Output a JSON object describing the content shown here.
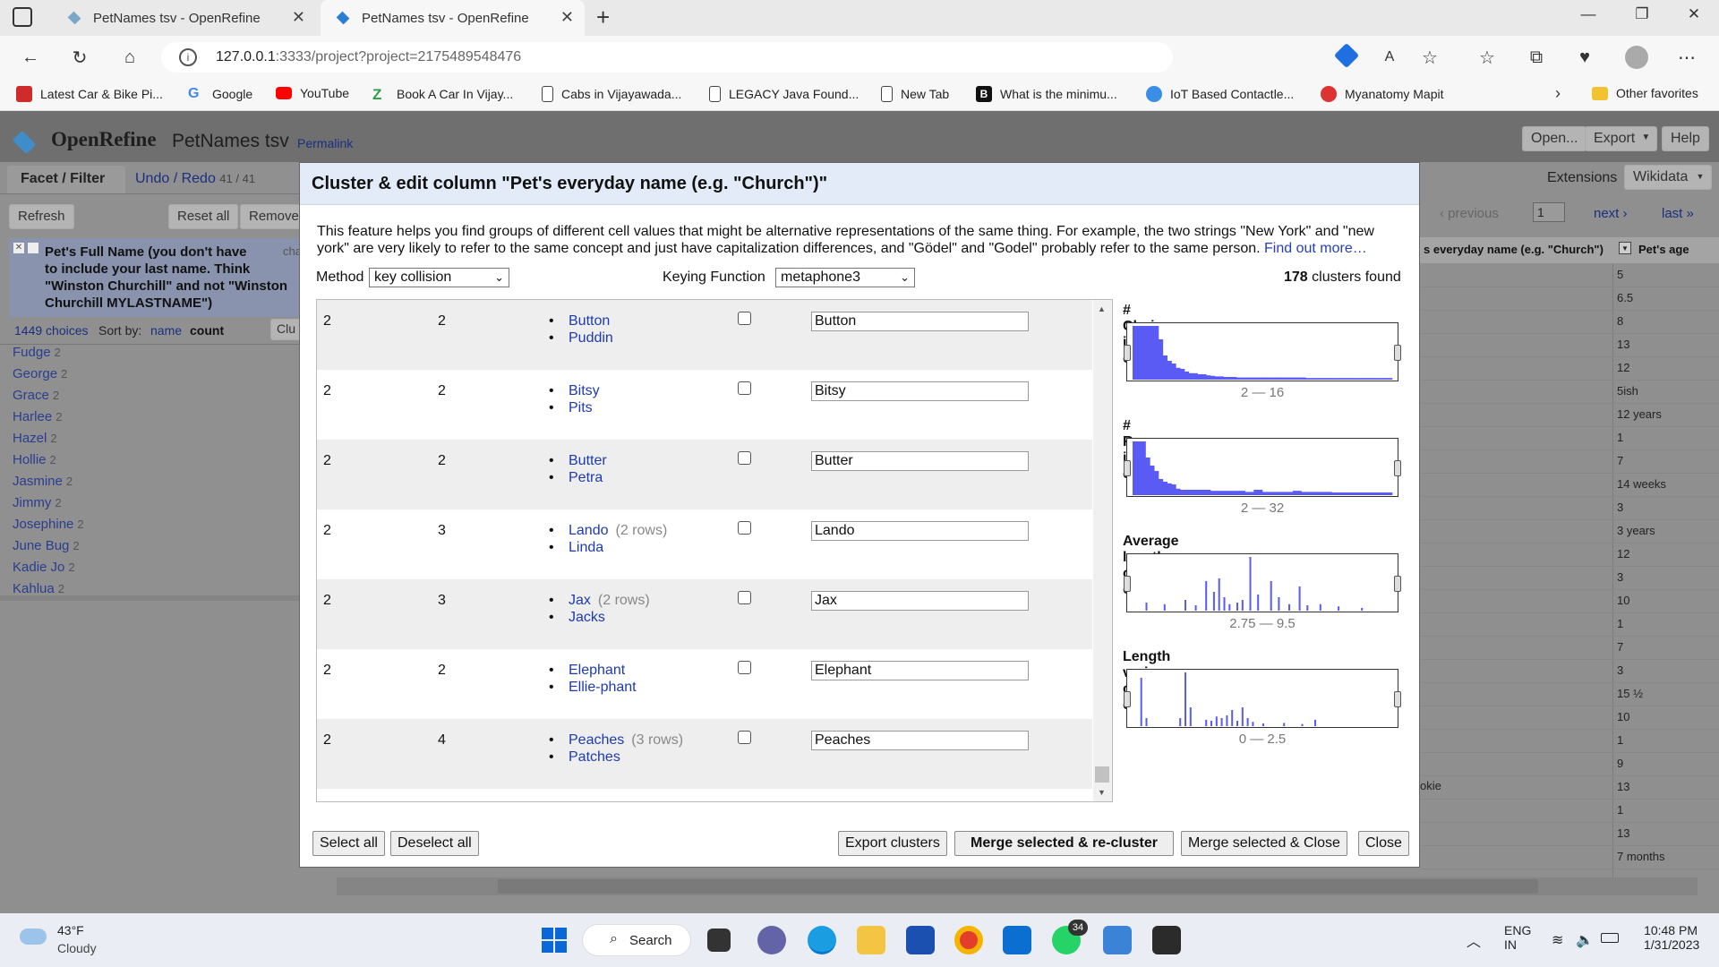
{
  "browser": {
    "tabs": [
      {
        "title": "PetNames tsv - OpenRefine"
      },
      {
        "title": "PetNames tsv - OpenRefine"
      }
    ],
    "url_host": "127.0.0.1",
    "url_rest": ":3333/project?project=2175489548476",
    "bookmarks": [
      {
        "label": "Latest Car & Bike Pi...",
        "color": "#d02b2b"
      },
      {
        "label": "Google",
        "color": "#4285f4"
      },
      {
        "label": "YouTube",
        "color": "#ff0000"
      },
      {
        "label": "Book A Car In Vijay...",
        "color": "#2e9e45"
      },
      {
        "label": "Cabs in Vijayawada...",
        "color": "#ffffff"
      },
      {
        "label": "LEGACY Java Found...",
        "color": "#ffffff"
      },
      {
        "label": "New Tab",
        "color": "#ffffff"
      },
      {
        "label": "What is the minimu...",
        "color": "#111111"
      },
      {
        "label": "IoT Based Contactle...",
        "color": "#3a8ee6"
      },
      {
        "label": "Myanatomy Mapit",
        "color": "#d33"
      }
    ],
    "other_favorites": "Other favorites"
  },
  "app": {
    "logo": "OpenRefine",
    "project": "PetNames tsv",
    "permalink": "Permalink",
    "buttons": {
      "open": "Open...",
      "export": "Export",
      "help": "Help"
    },
    "left_tabs": {
      "facet_filter": "Facet / Filter",
      "undo_redo": "Undo / Redo",
      "undo_count": "41 / 41"
    },
    "left_buttons": {
      "refresh": "Refresh",
      "reset_all": "Reset all",
      "remove": "Remove"
    },
    "facet": {
      "title": "Pet's Full Name (you don't have to include your last name. Think \"Winston Churchill\" and not \"Winston Churchill MYLASTNAME\")",
      "title_lines": [
        "Pet's Full Name (you don't have",
        "to include your last name. Think",
        "\"Winston Churchill\" and not \"Winston",
        "Churchill MYLASTNAME\")"
      ],
      "choices": "1449 choices",
      "sort_by": "Sort by:",
      "sort_name": "name",
      "sort_count": "count",
      "cluster_btn": "Clu",
      "change": "cha",
      "items": [
        {
          "name": "Fudge",
          "count": "2"
        },
        {
          "name": "George",
          "count": "2"
        },
        {
          "name": "Grace",
          "count": "2"
        },
        {
          "name": "Harlee",
          "count": "2"
        },
        {
          "name": "Hazel",
          "count": "2"
        },
        {
          "name": "Hollie",
          "count": "2"
        },
        {
          "name": "Jasmine",
          "count": "2"
        },
        {
          "name": "Jimmy",
          "count": "2"
        },
        {
          "name": "Josephine",
          "count": "2"
        },
        {
          "name": "June Bug",
          "count": "2"
        },
        {
          "name": "Kadie Jo",
          "count": "2"
        },
        {
          "name": "Kahlua",
          "count": "2"
        }
      ]
    },
    "right": {
      "extensions": "Extensions",
      "wikidata": "Wikidata",
      "previous": "‹ previous",
      "page": "1",
      "next": "next ›",
      "last": "last »",
      "col_everyday": "s everyday name (e.g. \"Church\")",
      "col_age": "Pet's age",
      "ages": [
        "5",
        "6.5",
        "8",
        "13",
        "12",
        "5ish",
        "12 years",
        "1",
        "7",
        "14 weeks",
        "3",
        "3 years",
        "12",
        "3",
        "10",
        "1",
        "7",
        "3",
        "15 ½",
        "10",
        "1",
        "9",
        "13",
        "1",
        "13",
        "7 months"
      ],
      "partial_name": "okie"
    }
  },
  "dialog": {
    "title": "Cluster & edit column \"Pet's everyday name (e.g. \"Church\")\"",
    "description_1": "This feature helps you find groups of different cell values that might be alternative representations of the same thing. For example, the two strings \"New York\" and \"new",
    "description_2": "york\" are very likely to refer to the same concept and just have capitalization differences, and \"Gödel\" and \"Godel\" probably refer to the same person.",
    "find_out_more": "Find out more…",
    "method_label": "Method",
    "method_value": "key collision",
    "keying_label": "Keying Function",
    "keying_value": "metaphone3",
    "clusters_count": "178",
    "clusters_found": "clusters found",
    "rows": [
      {
        "size": "2",
        "row_count": "2",
        "values": [
          {
            "v": "Button",
            "r": ""
          },
          {
            "v": "Puddin",
            "r": ""
          }
        ],
        "new_value": "Button"
      },
      {
        "size": "2",
        "row_count": "2",
        "values": [
          {
            "v": "Bitsy",
            "r": ""
          },
          {
            "v": "Pits",
            "r": ""
          }
        ],
        "new_value": "Bitsy"
      },
      {
        "size": "2",
        "row_count": "2",
        "values": [
          {
            "v": "Butter",
            "r": ""
          },
          {
            "v": "Petra",
            "r": ""
          }
        ],
        "new_value": "Butter"
      },
      {
        "size": "2",
        "row_count": "3",
        "values": [
          {
            "v": "Lando",
            "r": "(2 rows)"
          },
          {
            "v": "Linda",
            "r": ""
          }
        ],
        "new_value": "Lando"
      },
      {
        "size": "2",
        "row_count": "3",
        "values": [
          {
            "v": "Jax",
            "r": "(2 rows)"
          },
          {
            "v": "Jacks",
            "r": ""
          }
        ],
        "new_value": "Jax"
      },
      {
        "size": "2",
        "row_count": "2",
        "values": [
          {
            "v": "Elephant",
            "r": ""
          },
          {
            "v": "Ellie-phant",
            "r": ""
          }
        ],
        "new_value": "Elephant"
      },
      {
        "size": "2",
        "row_count": "4",
        "values": [
          {
            "v": "Peaches",
            "r": "(3 rows)"
          },
          {
            "v": "Patches",
            "r": ""
          }
        ],
        "new_value": "Peaches"
      }
    ],
    "histograms": [
      {
        "title": "# Choices in cluster",
        "range": "2 — 16",
        "bars": [
          1,
          1,
          1,
          1,
          1,
          1,
          0.75,
          0.45,
          0.35,
          0.3,
          0.22,
          0.2,
          0.15,
          0.12,
          0.12,
          0.1,
          0.1,
          0.08,
          0.07,
          0.06,
          0.06,
          0.05,
          0.05,
          0.05,
          0.04,
          0.04,
          0.04,
          0.04,
          0.04,
          0.04,
          0.04,
          0.04,
          0.04,
          0.04,
          0.04,
          0.04,
          0.04,
          0.04,
          0.04,
          0.04,
          0.03,
          0.03,
          0.03,
          0.03,
          0.03,
          0.03,
          0.03,
          0.03,
          0.03,
          0.03,
          0.03,
          0.03,
          0.03,
          0.03,
          0.03,
          0.03,
          0.03,
          0.03,
          0.03,
          0.03
        ],
        "mode": "filled"
      },
      {
        "title": "# Rows in cluster",
        "range": "2 — 32",
        "bars": [
          1,
          1,
          1,
          0.7,
          0.55,
          0.45,
          0.3,
          0.25,
          0.22,
          0.2,
          0.12,
          0.1,
          0.1,
          0.1,
          0.1,
          0.1,
          0.1,
          0.1,
          0.08,
          0.08,
          0.08,
          0.08,
          0.08,
          0.08,
          0.08,
          0.08,
          0.06,
          0.06,
          0.1,
          0.1,
          0.06,
          0.06,
          0.06,
          0.06,
          0.06,
          0.06,
          0.06,
          0.08,
          0.08,
          0.06,
          0.06,
          0.06,
          0.06,
          0.06,
          0.06,
          0.06,
          0.05,
          0.05,
          0.05,
          0.05,
          0.05,
          0.05,
          0.05,
          0.05,
          0.05,
          0.05,
          0.05,
          0.05,
          0.05,
          0.05
        ],
        "mode": "filled"
      },
      {
        "title": "Average length of choices",
        "range": "2.75 — 9.5",
        "spikes": [
          [
            0.05,
            0.15
          ],
          [
            0.12,
            0.12
          ],
          [
            0.2,
            0.2
          ],
          [
            0.24,
            0.1
          ],
          [
            0.28,
            0.55
          ],
          [
            0.31,
            0.35
          ],
          [
            0.33,
            0.6
          ],
          [
            0.35,
            0.25
          ],
          [
            0.37,
            0.12
          ],
          [
            0.4,
            0.15
          ],
          [
            0.42,
            0.2
          ],
          [
            0.45,
            1.0
          ],
          [
            0.48,
            0.3
          ],
          [
            0.53,
            0.55
          ],
          [
            0.56,
            0.25
          ],
          [
            0.6,
            0.12
          ],
          [
            0.64,
            0.45
          ],
          [
            0.67,
            0.1
          ],
          [
            0.72,
            0.12
          ],
          [
            0.79,
            0.08
          ],
          [
            0.88,
            0.05
          ]
        ]
      },
      {
        "title": "Length variance of choices",
        "range": "0 — 2.5",
        "spikes": [
          [
            0.03,
            0.9
          ],
          [
            0.05,
            0.15
          ],
          [
            0.18,
            0.15
          ],
          [
            0.2,
            1.0
          ],
          [
            0.22,
            0.35
          ],
          [
            0.28,
            0.12
          ],
          [
            0.3,
            0.1
          ],
          [
            0.32,
            0.18
          ],
          [
            0.34,
            0.15
          ],
          [
            0.36,
            0.2
          ],
          [
            0.38,
            0.3
          ],
          [
            0.4,
            0.1
          ],
          [
            0.42,
            0.35
          ],
          [
            0.44,
            0.15
          ],
          [
            0.46,
            0.08
          ],
          [
            0.5,
            0.05
          ],
          [
            0.58,
            0.06
          ],
          [
            0.65,
            0.04
          ],
          [
            0.7,
            0.12
          ]
        ]
      }
    ],
    "buttons": {
      "select_all": "Select all",
      "deselect_all": "Deselect all",
      "export_clusters": "Export clusters",
      "merge_recluster": "Merge selected & re-cluster",
      "merge_close": "Merge selected & Close",
      "close": "Close"
    }
  },
  "taskbar": {
    "weather_temp": "43°F",
    "weather_desc": "Cloudy",
    "search": "Search",
    "badge": "34",
    "lang_1": "ENG",
    "lang_2": "IN",
    "time": "10:48 PM",
    "date": "1/31/2023"
  },
  "colors": {
    "hist_fill": "#5a5af5",
    "link": "#2740b5",
    "accent": "#0078d4"
  }
}
